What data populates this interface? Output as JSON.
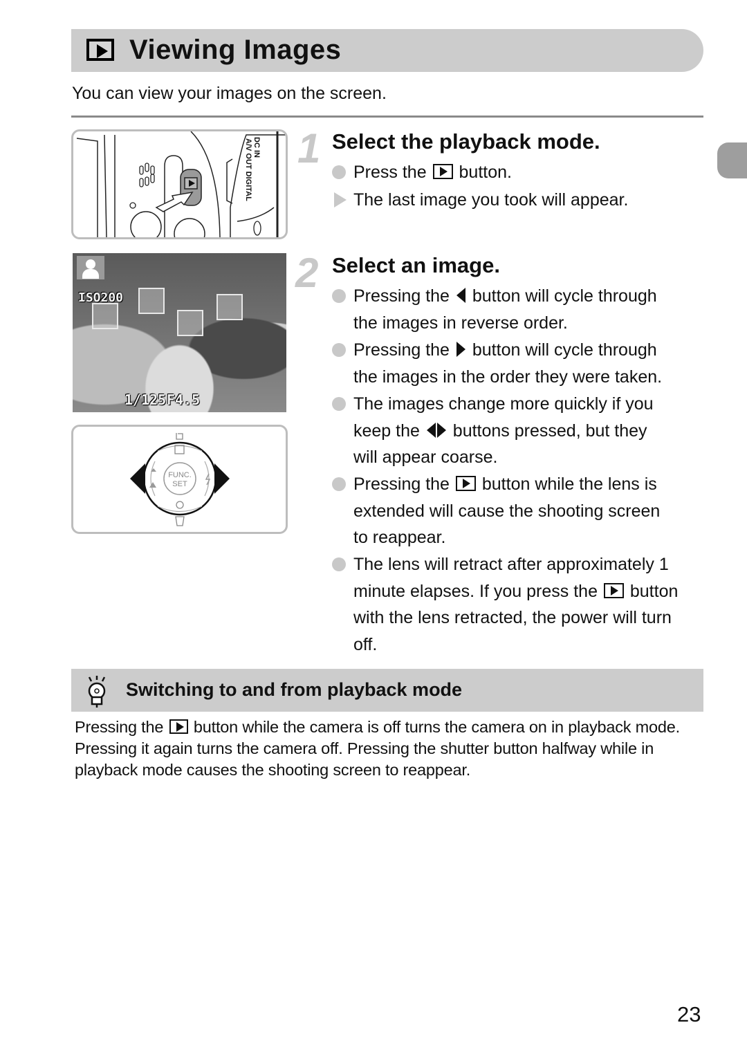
{
  "header": {
    "icon": "playback-icon",
    "title": "Viewing Images",
    "intro": "You can view your images on the screen."
  },
  "figures": {
    "camera_back": {
      "description": "Camera back panel with arrow pointing to playback button",
      "labels": [
        "DC IN",
        "A/V OUT DIGITAL"
      ]
    },
    "playback_screen": {
      "iso": "ISO200",
      "shutter": "1/125",
      "aperture": "F4.5",
      "face_frames": 4
    },
    "control_dial": {
      "center_label_1": "FUNC.",
      "center_label_2": "SET",
      "arrows": [
        "left",
        "right"
      ]
    }
  },
  "steps": [
    {
      "number": "1",
      "title": "Select the playback mode.",
      "items": [
        {
          "type": "dot",
          "parts": [
            "Press the ",
            "[playback]",
            " button."
          ]
        },
        {
          "type": "result",
          "parts": [
            "The last image you took will appear."
          ]
        }
      ]
    },
    {
      "number": "2",
      "title": "Select an image.",
      "items": [
        {
          "type": "dot",
          "line1_pre": "Pressing the ",
          "line1_post": " button will cycle through",
          "line2": "the images in reverse order."
        },
        {
          "type": "dot",
          "line1_pre": "Pressing the ",
          "line1_post": " button will cycle through",
          "line2": "the images in the order they were taken."
        },
        {
          "type": "dot",
          "line1": "The images change more quickly if you",
          "line2_pre": "keep the ",
          "line2_post": " buttons pressed, but they",
          "line3": "will appear coarse."
        },
        {
          "type": "dot",
          "line1_pre": "Pressing the ",
          "line1_post": " button while the lens is",
          "line2": "extended will cause the shooting screen",
          "line3": "to reappear."
        },
        {
          "type": "dot",
          "line1": "The lens will retract after approximately 1",
          "line2_pre": "minute elapses. If you press the ",
          "line2_post": " button",
          "line3": "with the lens retracted, the power will turn",
          "line4": "off."
        }
      ]
    }
  ],
  "tip": {
    "icon": "lightbulb-icon",
    "title": "Switching to and from playback mode",
    "body_pre": "Pressing the ",
    "body_post": " button while the camera is off turns the camera on in playback mode. Pressing it again turns the camera off. Pressing the shutter button halfway while in playback mode causes the shooting screen to reappear."
  },
  "page_number": "23",
  "colors": {
    "header_bar": "#cccccc",
    "bullet": "#c8c8c8",
    "side_tab": "#9e9e9e"
  }
}
